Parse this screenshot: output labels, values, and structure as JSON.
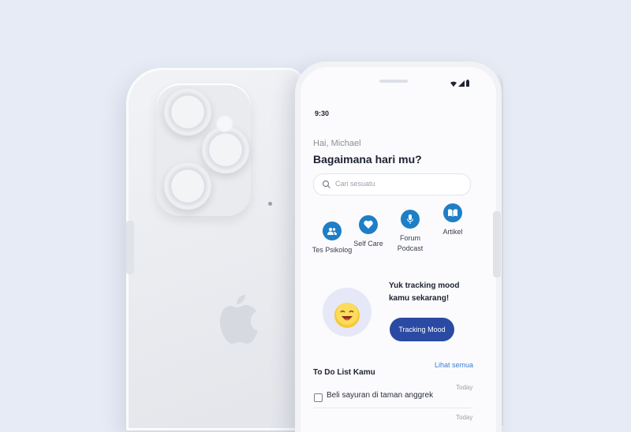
{
  "status_bar": {
    "time": "9:30"
  },
  "header": {
    "greeting": "Hai, Michael",
    "question": "Bagaimana hari mu?"
  },
  "search": {
    "placeholder": "Cari sesuatu"
  },
  "menu": [
    {
      "label": "Tes Psikolog",
      "icon": "people-icon"
    },
    {
      "label": "Self Care",
      "icon": "heart-icon"
    },
    {
      "label": "Forum Podcast",
      "icon": "microphone-icon"
    },
    {
      "label": "Artikel",
      "icon": "book-icon"
    }
  ],
  "mood": {
    "title": "Yuk tracking mood kamu sekarang!",
    "button_label": "Tracking Mood"
  },
  "todo": {
    "title": "To Do List Kamu",
    "see_all": "Lihat semua",
    "items": [
      {
        "text": "Beli sayuran di taman anggrek",
        "day": "Today"
      },
      {
        "text": "",
        "day": "Today"
      }
    ]
  },
  "colors": {
    "primary": "#1e7ec6",
    "button": "#2b4aa3",
    "link": "#3b7ed6",
    "background": "#e6ebf5"
  }
}
